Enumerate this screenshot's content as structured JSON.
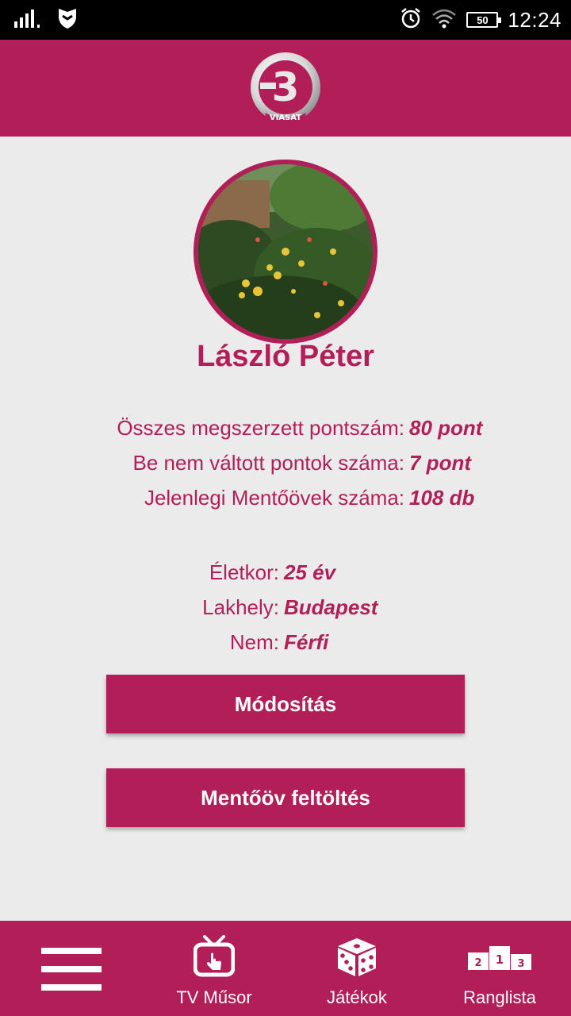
{
  "status_bar": {
    "time": "12:24",
    "battery": "50"
  },
  "header": {
    "logo_number": "3",
    "logo_text": "VIASAT"
  },
  "profile": {
    "name": "László Péter",
    "stats": [
      {
        "label": "Összes megszerzett pontszám:",
        "value": "80 pont"
      },
      {
        "label": "Be nem váltott pontok száma:",
        "value": "7 pont"
      },
      {
        "label": "Jelenlegi Mentőövek száma:",
        "value": "108 db"
      }
    ],
    "details": [
      {
        "label": "Életkor:",
        "value": "25 év"
      },
      {
        "label": "Lakhely:",
        "value": "Budapest"
      },
      {
        "label": "Nem:",
        "value": "Férfi"
      }
    ]
  },
  "buttons": {
    "modify": "Módosítás",
    "topup": "Mentőöv feltöltés"
  },
  "bottom_nav": {
    "items": [
      {
        "label": "",
        "icon": "menu-icon"
      },
      {
        "label": "TV Műsor",
        "icon": "tv-icon"
      },
      {
        "label": "Játékok",
        "icon": "dice-icon"
      },
      {
        "label": "Ranglista",
        "icon": "podium-icon"
      }
    ],
    "podium_numbers": [
      "2",
      "1",
      "3"
    ]
  },
  "colors": {
    "brand": "#b21e57",
    "background": "#ebebeb"
  }
}
